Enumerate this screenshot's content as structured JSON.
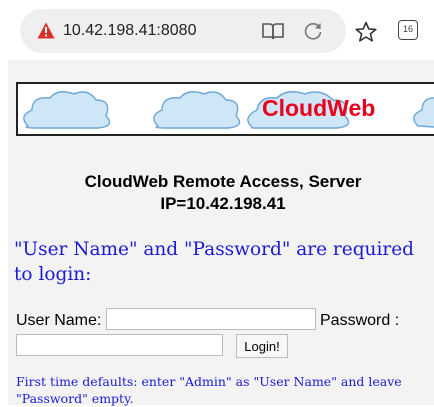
{
  "browser": {
    "url": "10.42.198.41:8080",
    "tab_count": "16",
    "icons": [
      "warning-icon",
      "reader-mode-icon",
      "reload-icon",
      "star-icon",
      "tabs-icon"
    ],
    "warning_color": "#d93025"
  },
  "banner": {
    "title": "CloudWeb",
    "title_color": "#e8001c"
  },
  "page": {
    "heading": "CloudWeb Remote Access, Server IP=10.42.198.41",
    "required_text": "\"User Name\" and \"Password\" are required to login:",
    "text_color": "#1a1ad6",
    "background": "#f3f3f3"
  },
  "login": {
    "user_label": "User Name:",
    "user_value": "",
    "password_label": "Password :",
    "password_value": "",
    "button_label": "Login!"
  },
  "defaults_note": "First time defaults: enter \"Admin\" as \"User Name\" and leave \"Password\" empty."
}
